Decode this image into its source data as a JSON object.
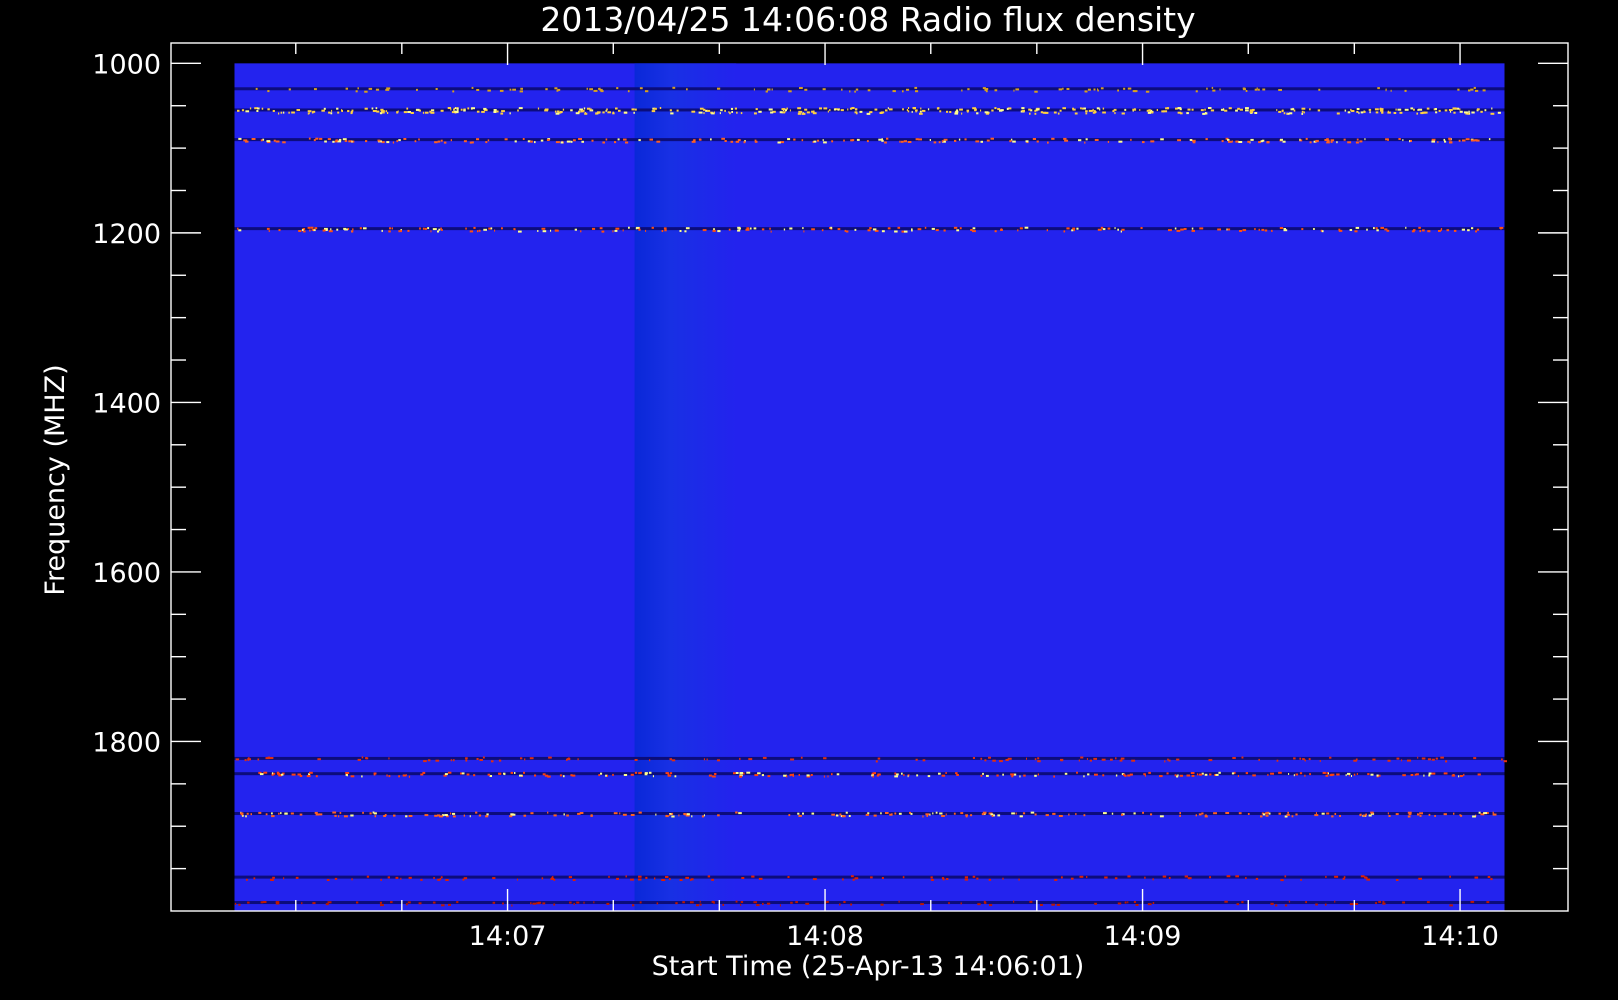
{
  "chart_data": {
    "type": "heatmap",
    "title": "2013/04/25 14:06:08 Radio flux density",
    "xlabel": "Start Time (25-Apr-13 14:06:01)",
    "ylabel": "Frequency (MHZ)",
    "x_major_ticks": [
      {
        "label": "14:07",
        "minutes": 1.0
      },
      {
        "label": "14:08",
        "minutes": 2.0
      },
      {
        "label": "14:09",
        "minutes": 3.0
      },
      {
        "label": "14:10",
        "minutes": 4.0
      }
    ],
    "x_minor_ticks_minutes": [
      0.333,
      0.667,
      1.333,
      1.667,
      2.333,
      2.667,
      3.333,
      3.667
    ],
    "xlim_minutes": [
      -0.06,
      4.34
    ],
    "data_xrange_minutes": [
      0.14,
      4.14
    ],
    "y_major_ticks": [
      1000,
      1200,
      1400,
      1600,
      1800
    ],
    "y_minor_ticks": [
      1050,
      1100,
      1150,
      1250,
      1300,
      1350,
      1450,
      1500,
      1550,
      1650,
      1700,
      1750,
      1850,
      1900,
      1950
    ],
    "ylim": [
      976,
      2000
    ],
    "data_yrange": [
      1000,
      2000
    ],
    "y_inverted": true,
    "background_level_color": "#2323ee",
    "step_change_minutes": 1.4,
    "emission_bands": [
      {
        "freq": 1030,
        "intensity": "weak",
        "color": "#d8a020"
      },
      {
        "freq": 1055,
        "intensity": "strong",
        "color": "#ffd040"
      },
      {
        "freq": 1090,
        "intensity": "medium",
        "color": "#ff6020"
      },
      {
        "freq": 1195,
        "intensity": "medium",
        "color": "#ff5010"
      },
      {
        "freq": 1820,
        "intensity": "weak",
        "color": "#e03010"
      },
      {
        "freq": 1838,
        "intensity": "medium",
        "color": "#ff4010"
      },
      {
        "freq": 1885,
        "intensity": "medium",
        "color": "#ff6020"
      },
      {
        "freq": 1960,
        "intensity": "weak",
        "color": "#e02000"
      },
      {
        "freq": 1990,
        "intensity": "weak",
        "color": "#c01800"
      }
    ],
    "colors": {
      "background": "#000000",
      "foreground": "#ffffff",
      "low": "#000060",
      "mid": "#2323ee",
      "high": "#ff2000",
      "peak": "#ffff80"
    }
  }
}
